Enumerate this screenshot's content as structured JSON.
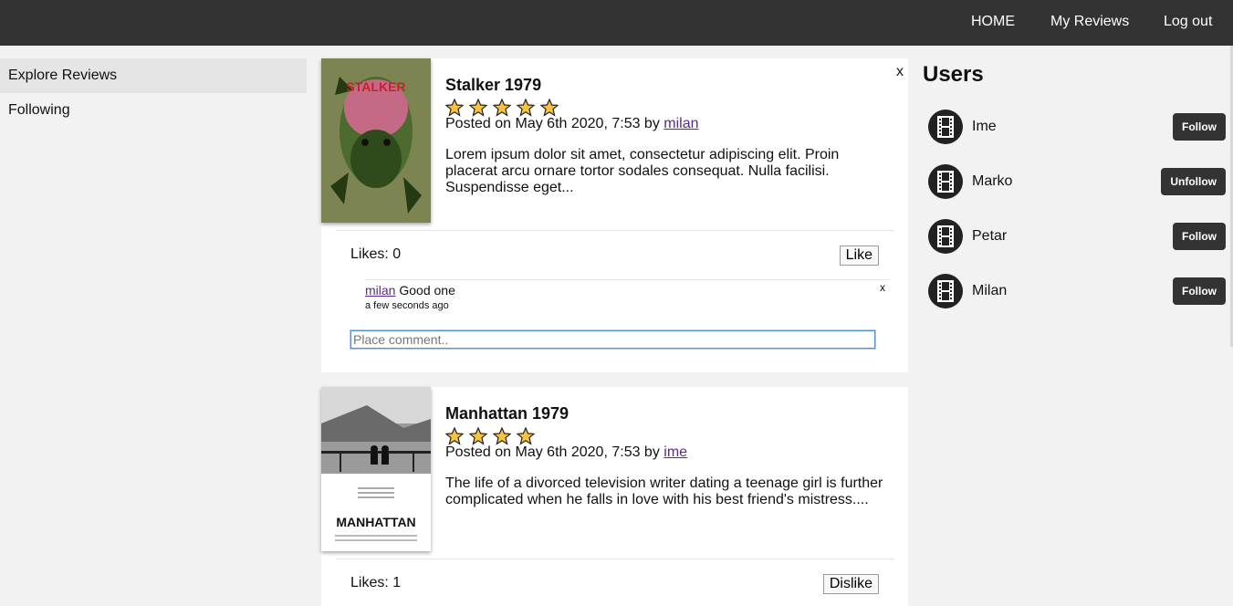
{
  "nav": {
    "home": "HOME",
    "my_reviews": "My Reviews",
    "logout": "Log out"
  },
  "sidebar": {
    "items": [
      {
        "label": "Explore Reviews",
        "active": true
      },
      {
        "label": "Following",
        "active": false
      }
    ]
  },
  "reviews": [
    {
      "title": "Stalker 1979",
      "stars": 5,
      "posted_prefix": "Posted on May 6th 2020, 7:53 by ",
      "author": "milan",
      "description": "Lorem ipsum dolor sit amet, consectetur adipiscing elit. Proin placerat arcu ornare tortor sodales consequat. Nulla facilisi. Suspendisse eget...",
      "close": "x",
      "likes": "Likes: 0",
      "like_button": "Like",
      "poster_text": "STALKER",
      "comments": [
        {
          "author": "milan",
          "text": " Good one",
          "time": "a few seconds ago",
          "close": "x"
        }
      ],
      "comment_placeholder": "Place comment.."
    },
    {
      "title": "Manhattan 1979",
      "stars": 4,
      "posted_prefix": "Posted on May 6th 2020, 7:53 by ",
      "author": "ime",
      "description": "The life of a divorced television writer dating a teenage girl is further complicated when he falls in love with his best friend's mistress....",
      "likes": "Likes: 1",
      "like_button": "Dislike",
      "poster_text": "MANHATTAN"
    }
  ],
  "users": {
    "title": "Users",
    "list": [
      {
        "name": "Ime",
        "action": "Follow"
      },
      {
        "name": "Marko",
        "action": "Unfollow"
      },
      {
        "name": "Petar",
        "action": "Follow"
      },
      {
        "name": "Milan",
        "action": "Follow"
      }
    ]
  },
  "colors": {
    "topbar": "#333333",
    "background": "#f2f2f2",
    "star_fill": "#f5c242",
    "link": "#5b2a86"
  }
}
